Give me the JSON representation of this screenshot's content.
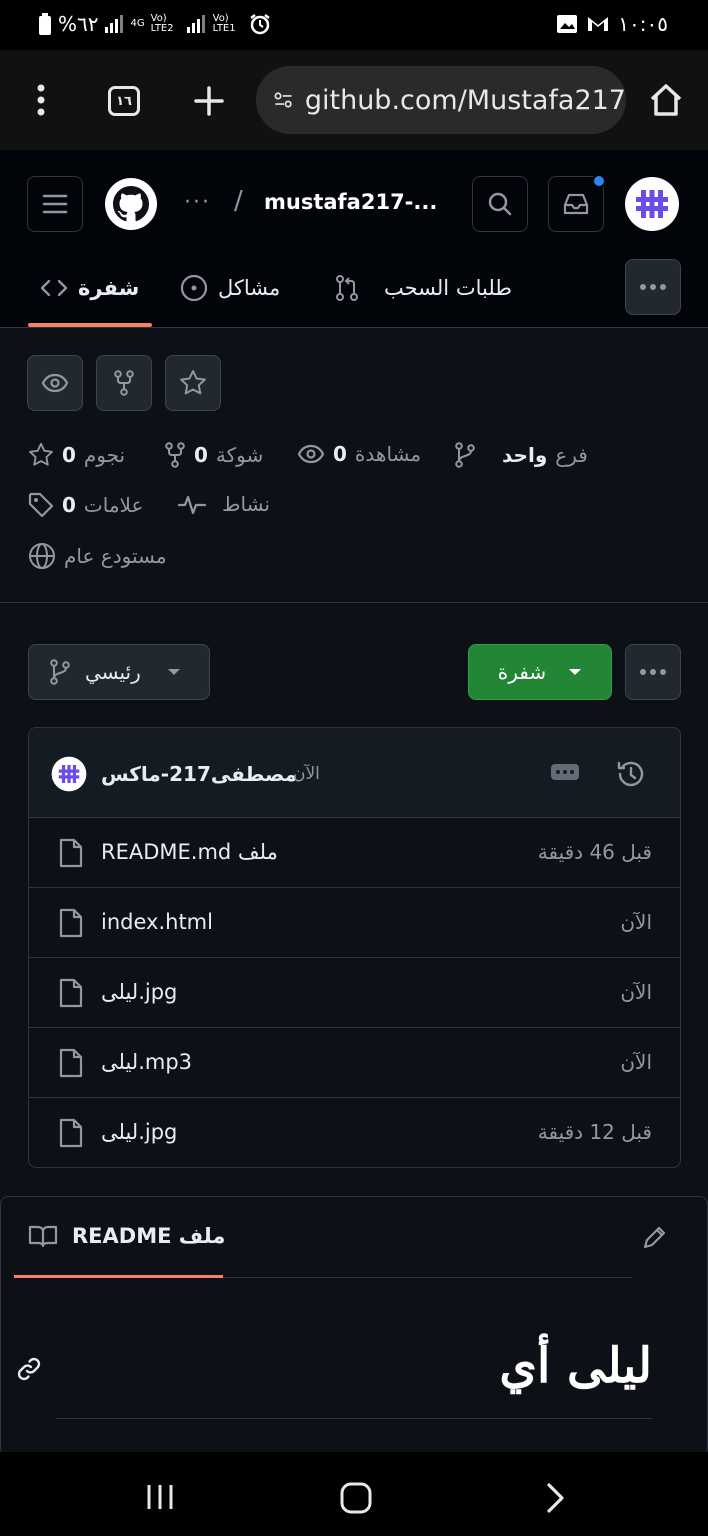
{
  "status_bar": {
    "battery": "%٦٢",
    "net1": "4G",
    "lte2": "Vo) LTE2",
    "lte1": "Vo) LTE1",
    "time": "١٠:٠٥"
  },
  "browser": {
    "tab_count": "١٦",
    "url": "github.com/Mustafa217"
  },
  "header": {
    "breadcrumb_more": "···",
    "separator": "/",
    "repo_name": "mustafa217-..."
  },
  "tabs": [
    {
      "label": "شفرة"
    },
    {
      "label": "مشاكل"
    },
    {
      "label": "طلبات السحب"
    }
  ],
  "stats": {
    "branches_label": "فرع",
    "branches_value": "واحد",
    "watching_label": "مشاهدة",
    "watching_value": "0",
    "forks_label": "شوكة",
    "forks_value": "0",
    "stars_label": "نجوم",
    "stars_value": "0",
    "activity_label": "نشاط",
    "tags_label": "علامات",
    "tags_value": "0",
    "visibility": "مستودع عام"
  },
  "branch_button": {
    "label": "رئيسي"
  },
  "code_button": {
    "label": "شفرة"
  },
  "commit": {
    "author": "مصطفى217-ماكس",
    "time": "الآن"
  },
  "files": [
    {
      "name": "README.md ملف",
      "time": "قبل 46 دقيقة"
    },
    {
      "name": "index.html",
      "time": "الآن"
    },
    {
      "name": "ليلى.jpg",
      "time": "الآن"
    },
    {
      "name": "ليلى.mp3",
      "time": "الآن"
    },
    {
      "name": "ليلى.jpg",
      "time": "قبل 12 دقيقة"
    }
  ],
  "readme": {
    "title": "README ملف",
    "heading": "ليلى أي"
  },
  "colors": {
    "bg": "#0d1117",
    "header_bg": "#010409",
    "accent_underline": "#f78166",
    "code_button": "#238636",
    "avatar_purple": "#6b4ce6",
    "notification_dot": "#2f81f7"
  }
}
